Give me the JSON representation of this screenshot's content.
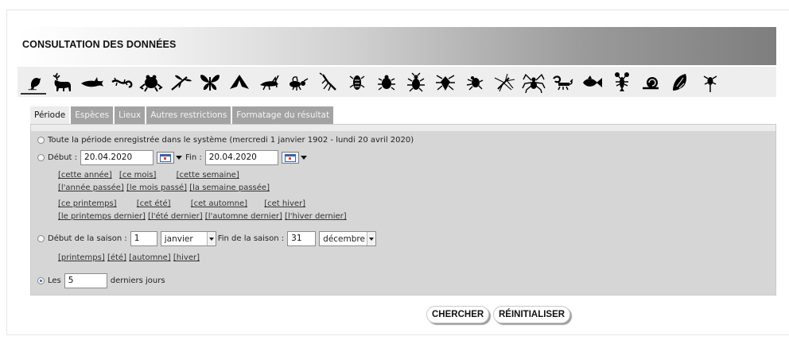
{
  "header": {
    "title": "CONSULTATION DES DONNÉES"
  },
  "taxa": [
    {
      "icon": "bird-icon"
    },
    {
      "icon": "deer-icon"
    },
    {
      "icon": "shark-icon"
    },
    {
      "icon": "lizard-icon"
    },
    {
      "icon": "frog-icon"
    },
    {
      "icon": "dragonfly-icon"
    },
    {
      "icon": "butterfly-icon"
    },
    {
      "icon": "moth-icon"
    },
    {
      "icon": "grasshopper-icon"
    },
    {
      "icon": "bee-icon"
    },
    {
      "icon": "mantis-icon"
    },
    {
      "icon": "cicada-icon"
    },
    {
      "icon": "ladybug-icon"
    },
    {
      "icon": "beetle-icon"
    },
    {
      "icon": "stink-bug-icon"
    },
    {
      "icon": "small-beetle-icon"
    },
    {
      "icon": "crane-fly-icon"
    },
    {
      "icon": "spider-icon"
    },
    {
      "icon": "scorpion-icon"
    },
    {
      "icon": "fish-icon"
    },
    {
      "icon": "crayfish-icon"
    },
    {
      "icon": "snail-icon"
    },
    {
      "icon": "shell-icon"
    },
    {
      "icon": "worm-icon"
    }
  ],
  "tabs": [
    {
      "label": "Période",
      "active": true
    },
    {
      "label": "Espèces"
    },
    {
      "label": "Lieux"
    },
    {
      "label": "Autres restrictions"
    },
    {
      "label": "Formatage du résultat"
    }
  ],
  "period": {
    "all_label": "Toute la période enregistrée dans le système (mercredi 1 janvier 1902 - lundi 20 avril 2020)",
    "start_label": "Début :",
    "start_value": "20.04.2020",
    "end_label": "Fin :",
    "end_value": "20.04.2020",
    "quick": {
      "this_year": "[cette année]",
      "this_month": "[ce mois]",
      "this_week": "[cette semaine]",
      "last_year": "[l'année passée]",
      "last_month": "[le mois passé]",
      "last_week": "[la semaine passée]",
      "this_spring": "[ce printemps]",
      "this_summer": "[cet été]",
      "this_autumn": "[cet automne]",
      "this_winter": "[cet hiver]",
      "last_spring": "[le printemps dernier]",
      "last_summer": "[l'été dernier]",
      "last_autumn": "[l'automne dernier]",
      "last_winter": "[l'hiver dernier]"
    },
    "season_start_label": "Début de la saison :",
    "season_start_day": "1",
    "season_start_month": "janvier",
    "season_end_label": "Fin de la saison :",
    "season_end_day": "31",
    "season_end_month": "décembre",
    "season_links": {
      "spring": "[printemps]",
      "summer": "[été]",
      "autumn": "[automne]",
      "winter": "[hiver]"
    },
    "last_days_prefix": "Les",
    "last_days_value": "5",
    "last_days_suffix": "derniers jours",
    "selected_option": "last_days"
  },
  "actions": {
    "search": "CHERCHER",
    "reset": "RÉINITIALISER"
  },
  "colors": {
    "tab_inactive": "#a3a3a3",
    "panel": "#d6d6d6",
    "radio_checked": "#2a6bd1"
  }
}
